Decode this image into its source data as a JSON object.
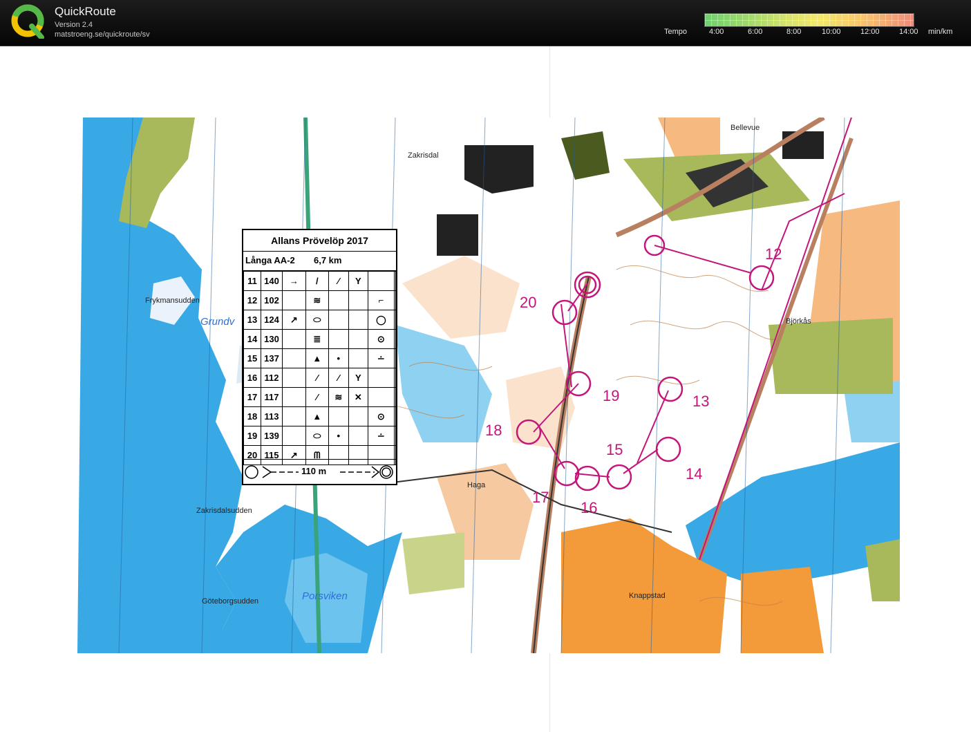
{
  "app": {
    "title": "QuickRoute",
    "version": "Version 2.4",
    "url": "matstroeng.se/quickroute/sv"
  },
  "legend": {
    "label": "Tempo",
    "ticks": [
      "4:00",
      "6:00",
      "8:00",
      "10:00",
      "12:00",
      "14:00"
    ],
    "unit": "min/km",
    "colors": [
      "#6fcf6f",
      "#d8e46a",
      "#f3e86a",
      "#f7c66a",
      "#f08a7a"
    ]
  },
  "map": {
    "placenames": [
      "Zakrisdal",
      "Bellevue",
      "Frykmansudden",
      "Björkås",
      "Haga",
      "Zakrisdalsudden",
      "Göteborgsudden",
      "Knappstad"
    ],
    "water_names": [
      "Grundv",
      "Porsviken"
    ],
    "controls": [
      "20",
      "12",
      "19",
      "13",
      "18",
      "15",
      "14",
      "17",
      "16"
    ],
    "colors": {
      "water": "#39a9e6",
      "course": "#c4157a",
      "open": "#f6b980",
      "green": "#a7b95a",
      "white": "#ffffff"
    }
  },
  "description": {
    "title": "Allans Prövelöp 2017",
    "course": "Långa AA-2",
    "length": "6,7 km",
    "rows": [
      {
        "num": "11",
        "code": "140"
      },
      {
        "num": "12",
        "code": "102"
      },
      {
        "num": "13",
        "code": "124"
      },
      {
        "num": "14",
        "code": "130"
      },
      {
        "num": "15",
        "code": "137"
      },
      {
        "num": "16",
        "code": "112"
      },
      {
        "num": "17",
        "code": "117"
      },
      {
        "num": "18",
        "code": "113"
      },
      {
        "num": "19",
        "code": "139"
      },
      {
        "num": "20",
        "code": "115"
      }
    ],
    "finish": "110 m"
  }
}
